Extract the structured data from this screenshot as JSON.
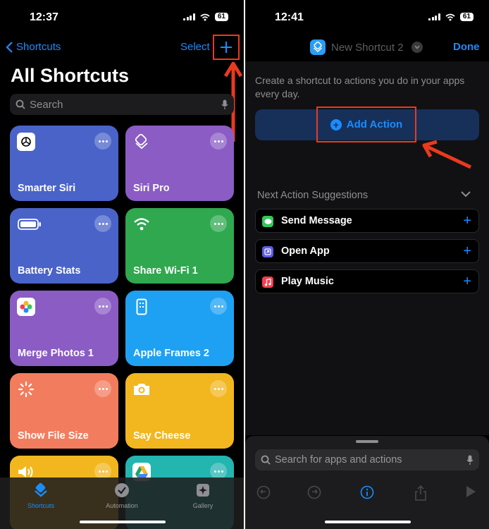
{
  "left": {
    "status": {
      "time": "12:37",
      "battery": "61"
    },
    "nav": {
      "back_label": "Shortcuts",
      "select_label": "Select",
      "add_symbol": "+"
    },
    "title": "All Shortcuts",
    "search": {
      "placeholder": "Search"
    },
    "tiles": [
      {
        "label": "Smarter Siri",
        "color": "#4a63c9",
        "icon": "chatgpt-icon"
      },
      {
        "label": "Siri Pro",
        "color": "#8a5cc4",
        "icon": "layers-icon"
      },
      {
        "label": "Battery Stats",
        "color": "#4a63c9",
        "icon": "battery-icon"
      },
      {
        "label": "Share Wi-Fi 1",
        "color": "#2fa84f",
        "icon": "wifi-icon"
      },
      {
        "label": "Merge Photos 1",
        "color": "#8a5cc4",
        "icon": "photos-icon"
      },
      {
        "label": "Apple Frames 2",
        "color": "#1ea1f2",
        "icon": "phone-frame-icon"
      },
      {
        "label": "Show File Size",
        "color": "#f27d5e",
        "icon": "loading-icon"
      },
      {
        "label": "Say Cheese",
        "color": "#f2b61f",
        "icon": "camera-icon"
      },
      {
        "label": "",
        "color": "#f2b61f",
        "icon": "speaker-icon"
      },
      {
        "label": "",
        "color": "#23b5b0",
        "icon": "drive-icon"
      }
    ],
    "tabs": [
      {
        "label": "Shortcuts",
        "icon": "layers-icon",
        "active": true
      },
      {
        "label": "Automation",
        "icon": "clock-check-icon",
        "active": false
      },
      {
        "label": "Gallery",
        "icon": "sparkle-icon",
        "active": false
      }
    ]
  },
  "right": {
    "status": {
      "time": "12:41",
      "battery": "61"
    },
    "nav": {
      "title": "New Shortcut 2",
      "done_label": "Done"
    },
    "intro": "Create a shortcut to actions you do in your apps every day.",
    "add_action_label": "Add Action",
    "suggestions_header": "Next Action Suggestions",
    "suggestions": [
      {
        "label": "Send Message",
        "icon": "messages-icon",
        "color": "#34c759"
      },
      {
        "label": "Open App",
        "icon": "open-app-icon",
        "color": "#5e5ce6"
      },
      {
        "label": "Play Music",
        "icon": "music-icon",
        "color": "#fa3c4c"
      }
    ],
    "search": {
      "placeholder": "Search for apps and actions"
    }
  },
  "colors": {
    "accent": "#1a8cff",
    "highlight": "#ea3a1c"
  }
}
